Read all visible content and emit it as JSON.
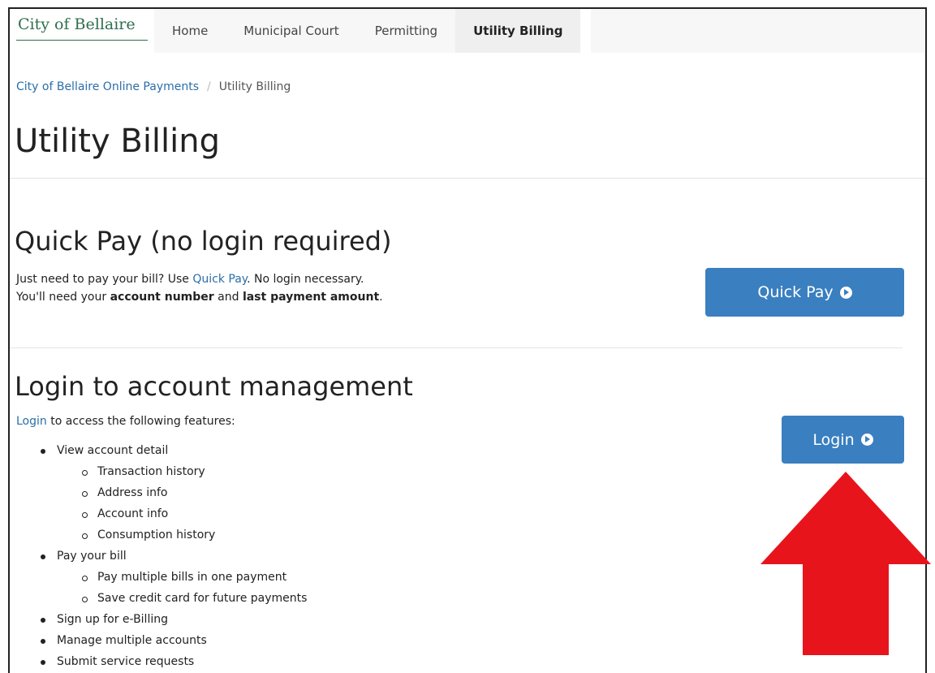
{
  "navbar": {
    "brand": "City of Bellaire",
    "links": [
      {
        "label": "Home",
        "active": false
      },
      {
        "label": "Municipal Court",
        "active": false
      },
      {
        "label": "Permitting",
        "active": false
      },
      {
        "label": "Utility Billing",
        "active": true
      }
    ]
  },
  "breadcrumb": {
    "parent": "City of Bellaire Online Payments",
    "separator": "/",
    "current": "Utility Billing"
  },
  "page_title": "Utility Billing",
  "quick_pay": {
    "heading": "Quick Pay (no login required)",
    "line1_prefix": "Just need to pay your bill? Use ",
    "line1_link": "Quick Pay",
    "line1_suffix": ". No login necessary.",
    "line2_prefix": "You'll need your ",
    "line2_bold1": "account number",
    "line2_mid": " and ",
    "line2_bold2": "last payment amount",
    "line2_suffix": ".",
    "button_label": "Quick Pay"
  },
  "login_section": {
    "heading": "Login to account management",
    "intro_link": "Login",
    "intro_text": " to access the following features:",
    "button_label": "Login",
    "features": [
      {
        "text": "View account detail",
        "level": 1
      },
      {
        "text": "Transaction history",
        "level": 2
      },
      {
        "text": "Address info",
        "level": 2
      },
      {
        "text": "Account info",
        "level": 2
      },
      {
        "text": "Consumption history",
        "level": 2
      },
      {
        "text": "Pay your bill",
        "level": 1
      },
      {
        "text": "Pay multiple bills in one payment",
        "level": 2
      },
      {
        "text": "Save credit card for future payments",
        "level": 2
      },
      {
        "text": "Sign up for e-Billing",
        "level": 1
      },
      {
        "text": "Manage multiple accounts",
        "level": 1
      },
      {
        "text": "Submit service requests",
        "level": 1
      }
    ]
  },
  "colors": {
    "brand_green": "#2e6e4e",
    "link_blue": "#2a6ea8",
    "button_blue": "#3a7fc0",
    "annotation_arrow_red": "#e8141c"
  }
}
